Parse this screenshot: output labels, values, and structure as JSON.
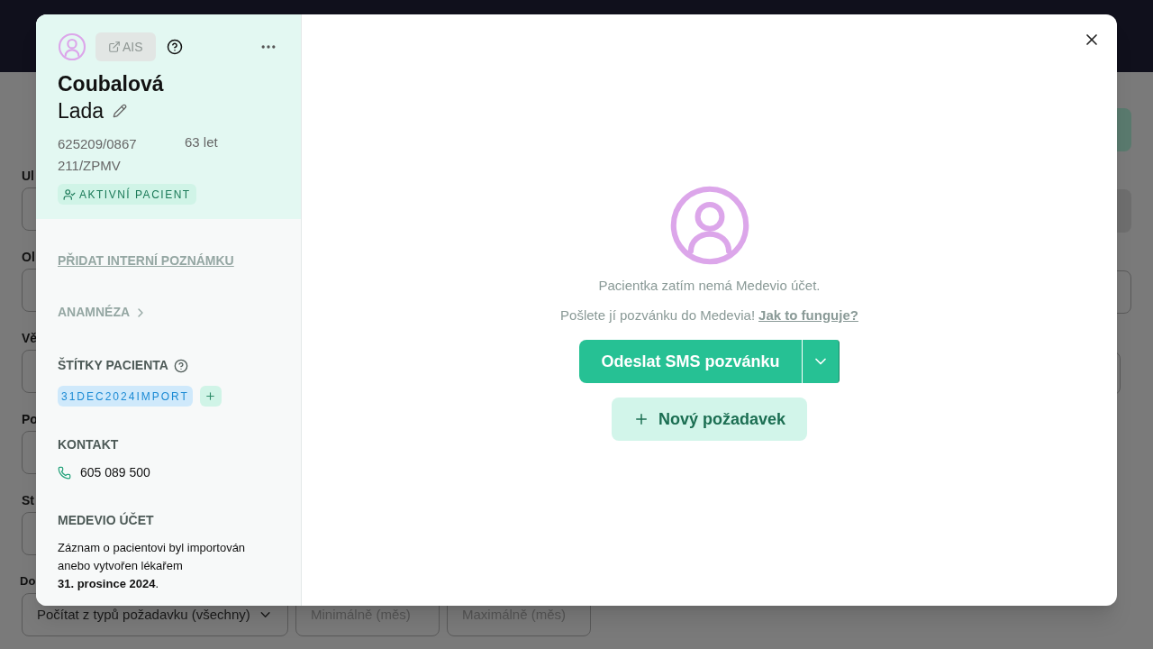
{
  "background_page": {
    "field_labels": [
      "Ul",
      "Ol",
      "Vě",
      "Po",
      "St",
      "Do"
    ],
    "bottom_row": {
      "select_value": "Počítat z typů požadavku (všechny)",
      "min_placeholder": "Minimálně (měs)",
      "max_placeholder": "Maximálně (měs)"
    }
  },
  "patient": {
    "ais_button": {
      "label": "AIS",
      "disabled": true
    },
    "surname": "Coubalová",
    "first_name": "Lada",
    "birth_number": "625209/0867",
    "age": "63 let",
    "insurance": "211/ZPMV",
    "status_badge": "AKTIVNÍ PACIENT"
  },
  "internal_note_link": "PŘIDAT INTERNÍ POZNÁMKU",
  "anamnesis": "ANAMNÉZA",
  "tags": {
    "title": "ŠTÍTKY PACIENTA",
    "items": [
      {
        "label": "31DEC2024IMPORT"
      }
    ]
  },
  "contact": {
    "title": "KONTAKT",
    "phone": "605 089 500"
  },
  "account": {
    "title": "MEDEVIO ÚČET",
    "text": "Záznam o pacientovi byl importován anebo vytvořen lékařem",
    "date": "**31. prosince 2024**."
  },
  "main": {
    "message": "Pacientka zatím nemá Medevio účet.",
    "invite_text": "Pošlete jí pozvánku do Medevia!",
    "help_link": "Jak to funguje?",
    "sms_button": "Odeslat SMS pozvánku",
    "new_request_button": "Nový požadavek"
  }
}
